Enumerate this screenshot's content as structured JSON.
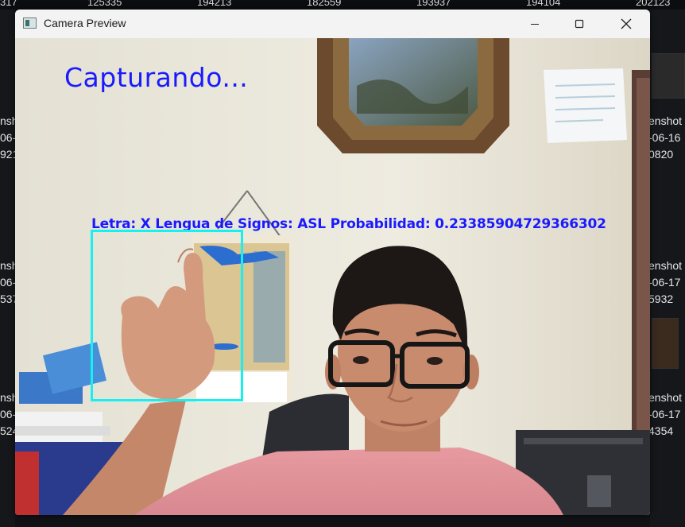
{
  "background": {
    "top_numbers": [
      "317",
      "125335",
      "194213",
      "182559",
      "193937",
      "194104",
      "202123"
    ],
    "left_labels": [
      [
        "nsh",
        "06-",
        "921"
      ],
      [
        "nsh",
        "06-",
        "537"
      ],
      [
        "nsh",
        "06-",
        "524"
      ]
    ],
    "right_labels": [
      [
        "enshot",
        "-06-16",
        "0820"
      ],
      [
        "enshot",
        "-06-17",
        "5932"
      ],
      [
        "enshot",
        "-06-17",
        "4354"
      ]
    ]
  },
  "window": {
    "title": "Camera Preview",
    "minimize_label": "Minimize",
    "maximize_label": "Maximize",
    "close_label": "Close"
  },
  "camera": {
    "status_text": "Capturando...",
    "prediction_text": "Letra: X  Lengua de Signos: ASL Probabilidad: 0.23385904729366302",
    "roi_color": "#16f0f0",
    "text_color": "#1a1aff"
  }
}
